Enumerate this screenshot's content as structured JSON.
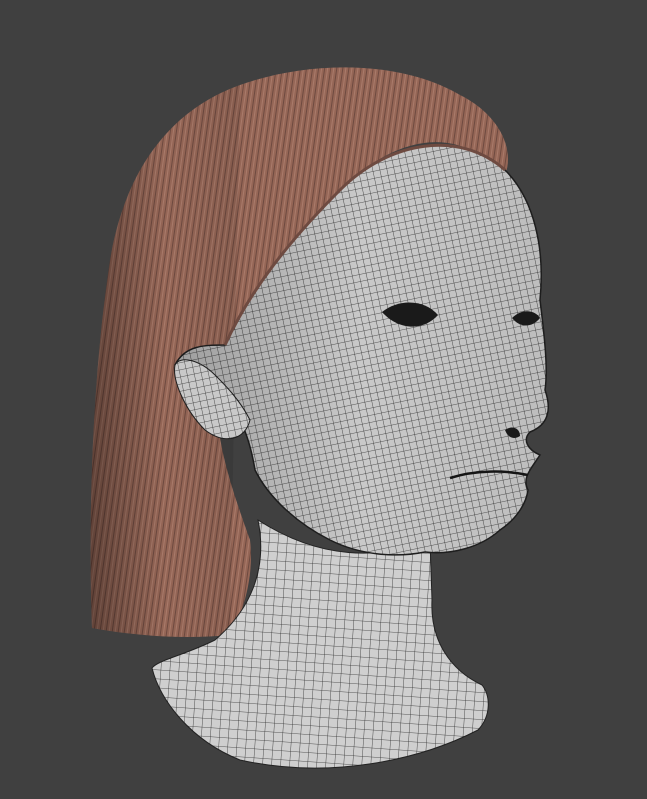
{
  "scene": {
    "background_color": "#404040",
    "hair_color": "#9a6a5c",
    "hair_shadow_color": "#6e4a40",
    "mesh_fill_color": "#c9c9c9",
    "mesh_line_color": "#2a2a2a"
  }
}
